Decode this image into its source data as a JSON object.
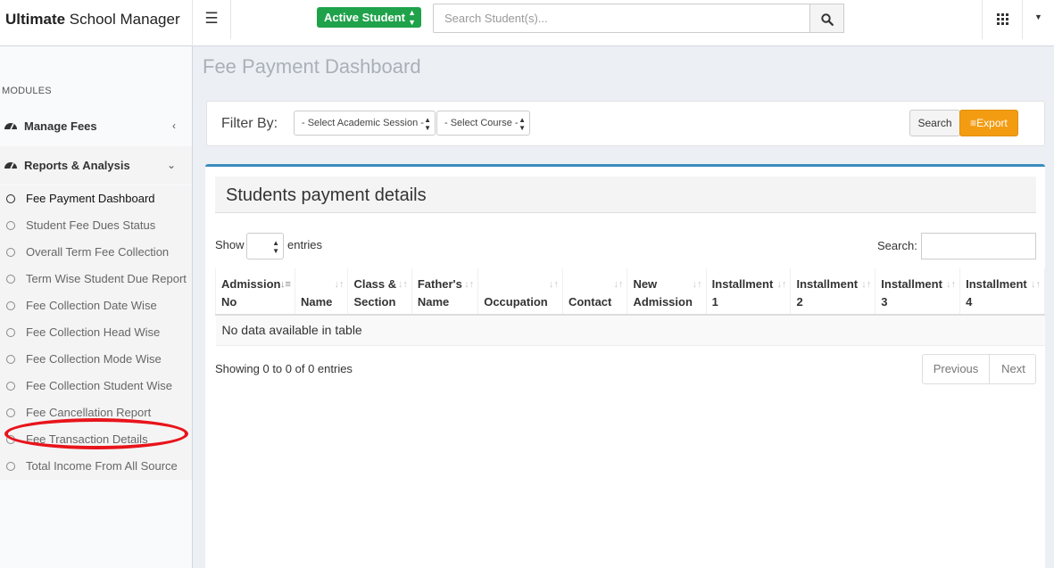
{
  "header": {
    "logo_bold": "Ultimate",
    "logo_rest": " School Manager",
    "active_student": "Active Student",
    "search_placeholder": "Search Student(s)..."
  },
  "sidebar": {
    "modules_label": "MODULES",
    "manage_fees": "Manage Fees",
    "reports": "Reports & Analysis",
    "sub_items": [
      "Fee Payment Dashboard",
      "Student Fee Dues Status",
      "Overall Term Fee Collection",
      "Term Wise Student Due Report",
      "Fee Collection Date Wise",
      "Fee Collection Head Wise",
      "Fee Collection Mode Wise",
      "Fee Collection Student Wise",
      "Fee Cancellation Report",
      "Fee Transaction Details",
      "Total Income From All Source"
    ]
  },
  "page": {
    "title": "Fee Payment Dashboard",
    "filter_label": "Filter By:",
    "session_select": "- Select Academic Session -",
    "course_select": "- Select Course -",
    "search_button": "Search",
    "export_button": "Export"
  },
  "table_box": {
    "title": "Students payment details",
    "show": "Show",
    "entries": "entries",
    "search_label": "Search:",
    "columns": [
      [
        "Admission",
        "No"
      ],
      [
        "",
        "Name"
      ],
      [
        "Class &",
        "Section"
      ],
      [
        "Father's",
        "Name"
      ],
      [
        "",
        "Occupation"
      ],
      [
        "",
        "Contact"
      ],
      [
        "New",
        "Admission"
      ],
      [
        "Installment",
        "1"
      ],
      [
        "Installment",
        "2"
      ],
      [
        "Installment",
        "3"
      ],
      [
        "Installment",
        "4"
      ]
    ],
    "empty_message": "No data available in table",
    "info": "Showing 0 to 0 of 0 entries",
    "previous": "Previous",
    "next": "Next"
  }
}
